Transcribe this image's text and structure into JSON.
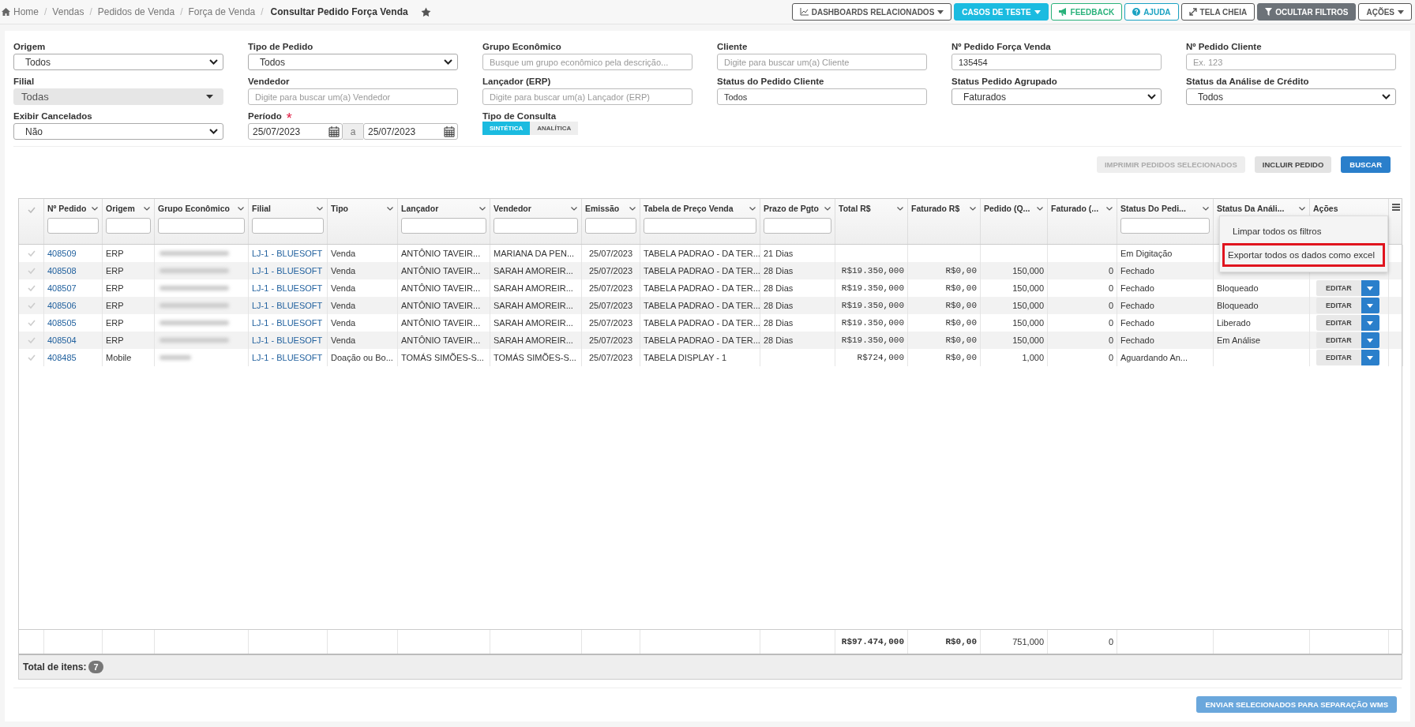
{
  "breadcrumbs": {
    "items": [
      "Home",
      "Vendas",
      "Pedidos de Venda",
      "Força de Venda",
      "Consultar Pedido Força Venda"
    ],
    "separator": "/"
  },
  "toolbar": [
    {
      "label": "DASHBOARDS RELACIONADOS",
      "kind": "dashboards"
    },
    {
      "label": "CASOS DE TESTE",
      "kind": "tests"
    },
    {
      "label": "FEEDBACK",
      "kind": "feedback"
    },
    {
      "label": "AJUDA",
      "kind": "help"
    },
    {
      "label": "TELA CHEIA",
      "kind": "fullscreen"
    },
    {
      "label": "OCULTAR FILTROS",
      "kind": "filters"
    },
    {
      "label": "AÇÕES",
      "kind": "actions"
    }
  ],
  "filters": [
    {
      "label": "Origem",
      "kind": "select",
      "value": "Todos",
      "disabled": false
    },
    {
      "label": "Tipo de Pedido",
      "kind": "select",
      "value": "Todos",
      "disabled": false
    },
    {
      "label": "Grupo Econômico",
      "kind": "input",
      "placeholder": "Busque um grupo econômico pela descrição..."
    },
    {
      "label": "Cliente",
      "kind": "input",
      "placeholder": "Digite para buscar um(a) Cliente"
    },
    {
      "label": "Nº Pedido Força Venda",
      "kind": "input",
      "value": "135454"
    },
    {
      "label": "Nº Pedido Cliente",
      "kind": "input",
      "placeholder": "Ex. 123"
    },
    {
      "label": "Filial",
      "kind": "select",
      "value": "Todas",
      "disabled": true
    },
    {
      "label": "Vendedor",
      "kind": "input",
      "placeholder": "Digite para buscar um(a) Vendedor"
    },
    {
      "label": "Lançador (ERP)",
      "kind": "input",
      "placeholder": "Digite para buscar um(a) Lançador (ERP)"
    },
    {
      "label": "Status do Pedido Cliente",
      "kind": "input",
      "value": "Todos"
    },
    {
      "label": "Status Pedido Agrupado",
      "kind": "select",
      "value": "Faturados",
      "disabled": false
    },
    {
      "label": "Status da Análise de Crédito",
      "kind": "select",
      "value": "Todos",
      "disabled": false
    },
    {
      "label": "Exibir Cancelados",
      "kind": "select",
      "value": "Não",
      "disabled": false
    },
    {
      "label": "Período",
      "kind": "daterange",
      "required_mark": "*",
      "from": "25/07/2023",
      "separator": "a",
      "to": "25/07/2023"
    },
    {
      "label": "Tipo de Consulta",
      "kind": "toggle",
      "options": [
        {
          "label": "SINTÉTICA",
          "selected": true
        },
        {
          "label": "ANALÍTICA",
          "selected": false
        }
      ]
    }
  ],
  "actions": [
    {
      "label": "IMPRIMIR PEDIDOS SELECIONADOS",
      "kind": "disabled"
    },
    {
      "label": "INCLUIR PEDIDO",
      "kind": "default"
    },
    {
      "label": "BUSCAR",
      "kind": "primary"
    }
  ],
  "table": {
    "columns": [
      {
        "label": "Nº Pedido",
        "kind": "link",
        "filter": true
      },
      {
        "label": "Origem",
        "kind": "text",
        "filter": true
      },
      {
        "label": "Grupo Econômico",
        "kind": "blurred",
        "filter": true
      },
      {
        "label": "Filial",
        "kind": "link",
        "filter": true
      },
      {
        "label": "Tipo",
        "kind": "text",
        "filter": false
      },
      {
        "label": "Lançador",
        "kind": "text",
        "filter": true
      },
      {
        "label": "Vendedor",
        "kind": "text",
        "filter": true
      },
      {
        "label": "Emissão",
        "kind": "center",
        "filter": true
      },
      {
        "label": "Tabela de Preço Venda",
        "kind": "text",
        "filter": true
      },
      {
        "label": "Prazo de Pgto",
        "kind": "text",
        "filter": true
      },
      {
        "label": "Total R$",
        "kind": "money",
        "filter": false
      },
      {
        "label": "Faturado R$",
        "kind": "money",
        "filter": false
      },
      {
        "label": "Pedido (Q...",
        "kind": "number",
        "filter": false
      },
      {
        "label": "Faturado (...",
        "kind": "number",
        "filter": false
      },
      {
        "label": "Status Do Pedi...",
        "kind": "text",
        "filter": true
      },
      {
        "label": "Status Da Análi...",
        "kind": "text",
        "filter": false
      }
    ],
    "actions_label": "Ações",
    "rows": [
      {
        "selected": false,
        "order": "408509",
        "origin": "ERP",
        "branch": "LJ-1 - BLUESOFT",
        "type": "Venda",
        "launcher": "ANTÔNIO TAVEIR...",
        "seller": "MARIANA DA PEN...",
        "issued": "25/07/2023",
        "price_table": "TABELA PADRAO - DA TER...",
        "terms": "21 Dias",
        "order_status": "Em Digitação"
      },
      {
        "selected": false,
        "order": "408508",
        "origin": "ERP",
        "branch": "LJ-1 - BLUESOFT",
        "type": "Venda",
        "launcher": "ANTÔNIO TAVEIR...",
        "seller": "SARAH AMOREIR...",
        "issued": "25/07/2023",
        "price_table": "TABELA PADRAO - DA TER...",
        "terms": "28 Dias",
        "total": "R$19.350,000",
        "billed": "R$0,00",
        "qty_ordered": "150,000",
        "qty_billed": "0",
        "order_status": "Fechado"
      },
      {
        "selected": false,
        "order": "408507",
        "origin": "ERP",
        "branch": "LJ-1 - BLUESOFT",
        "type": "Venda",
        "launcher": "ANTÔNIO TAVEIR...",
        "seller": "SARAH AMOREIR...",
        "issued": "25/07/2023",
        "price_table": "TABELA PADRAO - DA TER...",
        "terms": "28 Dias",
        "total": "R$19.350,000",
        "billed": "R$0,00",
        "qty_ordered": "150,000",
        "qty_billed": "0",
        "order_status": "Fechado",
        "credit_status": "Bloqueado",
        "action": "EDITAR"
      },
      {
        "selected": false,
        "order": "408506",
        "origin": "ERP",
        "branch": "LJ-1 - BLUESOFT",
        "type": "Venda",
        "launcher": "ANTÔNIO TAVEIR...",
        "seller": "SARAH AMOREIR...",
        "issued": "25/07/2023",
        "price_table": "TABELA PADRAO - DA TER...",
        "terms": "28 Dias",
        "total": "R$19.350,000",
        "billed": "R$0,00",
        "qty_ordered": "150,000",
        "qty_billed": "0",
        "order_status": "Fechado",
        "credit_status": "Bloqueado",
        "action": "EDITAR"
      },
      {
        "selected": false,
        "order": "408505",
        "origin": "ERP",
        "branch": "LJ-1 - BLUESOFT",
        "type": "Venda",
        "launcher": "ANTÔNIO TAVEIR...",
        "seller": "SARAH AMOREIR...",
        "issued": "25/07/2023",
        "price_table": "TABELA PADRAO - DA TER...",
        "terms": "28 Dias",
        "total": "R$19.350,000",
        "billed": "R$0,00",
        "qty_ordered": "150,000",
        "qty_billed": "0",
        "order_status": "Fechado",
        "credit_status": "Liberado",
        "action": "EDITAR"
      },
      {
        "selected": false,
        "order": "408504",
        "origin": "ERP",
        "branch": "LJ-1 - BLUESOFT",
        "type": "Venda",
        "launcher": "ANTÔNIO TAVEIR...",
        "seller": "SARAH AMOREIR...",
        "issued": "25/07/2023",
        "price_table": "TABELA PADRAO - DA TER...",
        "terms": "28 Dias",
        "total": "R$19.350,000",
        "billed": "R$0,00",
        "qty_ordered": "150,000",
        "qty_billed": "0",
        "order_status": "Fechado",
        "credit_status": "Em Análise",
        "action": "EDITAR"
      },
      {
        "selected": false,
        "order": "408485",
        "origin": "Mobile",
        "branch": "LJ-1 - BLUESOFT",
        "type": "Doação ou Bo...",
        "launcher": "TOMÁS SIMÕES-S...",
        "seller": "TOMÁS SIMÕES-S...",
        "issued": "25/07/2023",
        "price_table": "TABELA DISPLAY - 1",
        "total": "R$724,000",
        "billed": "R$0,00",
        "qty_ordered": "1,000",
        "qty_billed": "0",
        "order_status": "Aguardando An...",
        "action": "EDITAR"
      }
    ],
    "totals": {
      "total": "R$97.474,000",
      "billed": "R$0,00",
      "qty_ordered": "751,000",
      "qty_billed": "0"
    },
    "footer": {
      "label": "Total de itens:",
      "count": "7"
    },
    "menu": [
      {
        "label": "Limpar todos os filtros",
        "highlighted": false
      },
      {
        "label": "Exportar todos os dados como excel",
        "highlighted": true
      }
    ]
  },
  "bottom_button": "ENVIAR SELECIONADOS PARA SEPARAÇÃO WMS"
}
